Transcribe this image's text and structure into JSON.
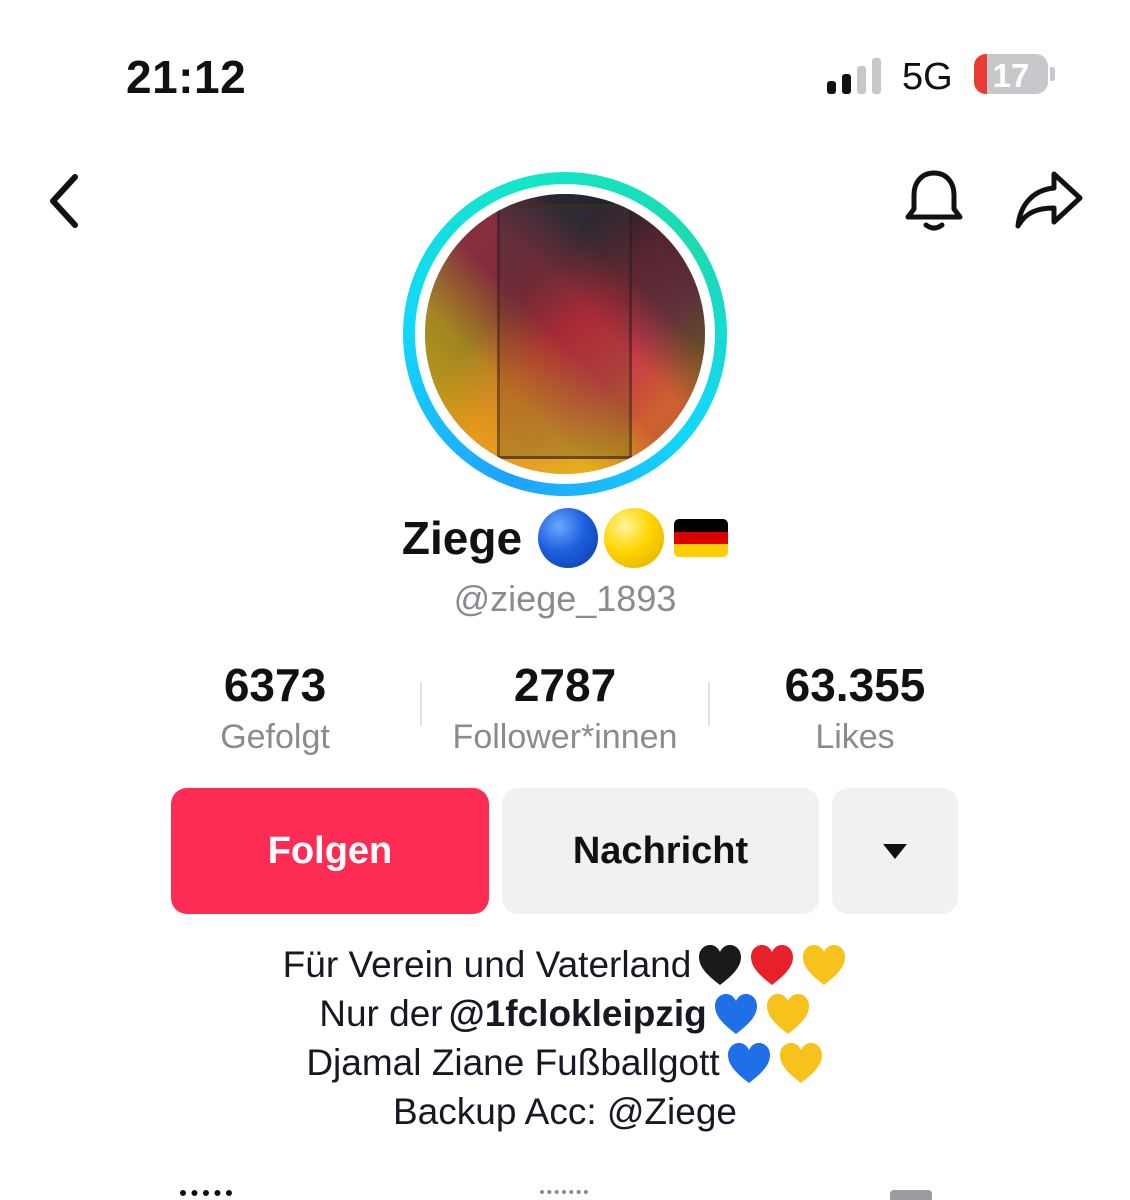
{
  "status_bar": {
    "time": "21:12",
    "network": "5G",
    "battery_percent": "17",
    "battery_level": 0.17,
    "signal_icon": "signal-bars-icon",
    "battery_icon": "battery-icon"
  },
  "nav": {
    "back_icon": "chevron-left-icon",
    "bell_icon": "bell-icon",
    "share_icon": "share-arrow-icon"
  },
  "profile": {
    "display_name": "Ziege",
    "name_emojis": [
      "blue-circle",
      "yellow-circle",
      "german-flag"
    ],
    "username": "@ziege_1893",
    "ring_colors": [
      "#1fa2ff",
      "#12d8fa",
      "#14e6c9"
    ]
  },
  "stats": [
    {
      "value": "6373",
      "label": "Gefolgt"
    },
    {
      "value": "2787",
      "label": "Follower*innen"
    },
    {
      "value": "63.355",
      "label": "Likes"
    }
  ],
  "actions": {
    "follow_label": "Folgen",
    "message_label": "Nachricht",
    "more_icon": "caret-down-icon",
    "follow_color": "#fe2c55"
  },
  "bio": {
    "line1_text": "Für Verein und Vaterland",
    "line1_emojis": [
      "black-heart",
      "red-heart",
      "yellow-heart"
    ],
    "line2_prefix": "Nur der",
    "line2_mention": "@1fclokleipzig",
    "line2_emojis": [
      "blue-heart",
      "yellow-heart"
    ],
    "line3_text": "Djamal Ziane Fußballgott",
    "line3_emojis": [
      "blue-heart",
      "yellow-heart"
    ],
    "line4_text": "Backup Acc: @Ziege"
  }
}
